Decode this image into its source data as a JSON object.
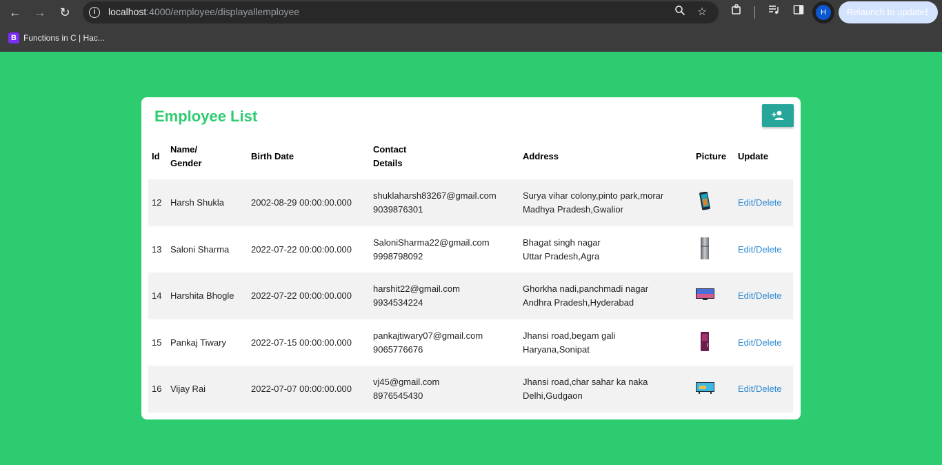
{
  "browser": {
    "url_host": "localhost",
    "url_path": ":4000/employee/displayallemployee",
    "relaunch_label": "Relaunch to update",
    "profile_initial": "H",
    "bookmark_icon_letter": "B",
    "bookmark_label": "Functions in C | Hac...",
    "icons": [
      "back-icon",
      "forward-icon",
      "reload-icon",
      "site-info-icon",
      "zoom-icon",
      "bookmark-star-icon",
      "extensions-icon",
      "media-icon",
      "side-panel-icon",
      "more-icon"
    ]
  },
  "page": {
    "title": "Employee List",
    "add_button_icon": "person-add-icon",
    "colors": {
      "background": "#2ecc71",
      "title": "#2ecc71",
      "button": "#26a69a",
      "link": "#2a88d2"
    }
  },
  "table": {
    "headers": {
      "id": "Id",
      "name_line1": "Name/",
      "name_line2": "Gender",
      "birth": "Birth Date",
      "contact_line1": "Contact",
      "contact_line2": "Details",
      "address": "Address",
      "picture": "Picture",
      "update": "Update"
    },
    "rows": [
      {
        "id": "12",
        "name": "Harsh Shukla",
        "birth": "2002-08-29 00:00:00.000",
        "email": "shuklaharsh83267@gmail.com",
        "phone": "9039876301",
        "address1": "Surya vihar colony,pinto park,morar",
        "address2": "Madhya Pradesh,Gwalior",
        "picture": "phone-image",
        "action": "Edit/Delete"
      },
      {
        "id": "13",
        "name": "Saloni Sharma",
        "birth": "2022-07-22 00:00:00.000",
        "email": "SaloniSharma22@gmail.com",
        "phone": "9998798092",
        "address1": "Bhagat singh nagar",
        "address2": "Uttar Pradesh,Agra",
        "picture": "refrigerator-image",
        "action": "Edit/Delete"
      },
      {
        "id": "14",
        "name": "Harshita Bhogle",
        "birth": "2022-07-22 00:00:00.000",
        "email": "harshit22@gmail.com",
        "phone": "9934534224",
        "address1": "Ghorkha nadi,panchmadi nagar",
        "address2": "Andhra Pradesh,Hyderabad",
        "picture": "television-image",
        "action": "Edit/Delete"
      },
      {
        "id": "15",
        "name": "Pankaj Tiwary",
        "birth": "2022-07-15 00:00:00.000",
        "email": "pankajtiwary07@gmail.com",
        "phone": "9065776676",
        "address1": "Jhansi road,begam gali",
        "address2": "Haryana,Sonipat",
        "picture": "refrigerator-image",
        "action": "Edit/Delete"
      },
      {
        "id": "16",
        "name": "Vijay Rai",
        "birth": "2022-07-07 00:00:00.000",
        "email": "vj45@gmail.com",
        "phone": "8976545430",
        "address1": "Jhansi road,char sahar ka naka",
        "address2": "Delhi,Gudgaon",
        "picture": "television-image",
        "action": "Edit/Delete"
      }
    ]
  }
}
